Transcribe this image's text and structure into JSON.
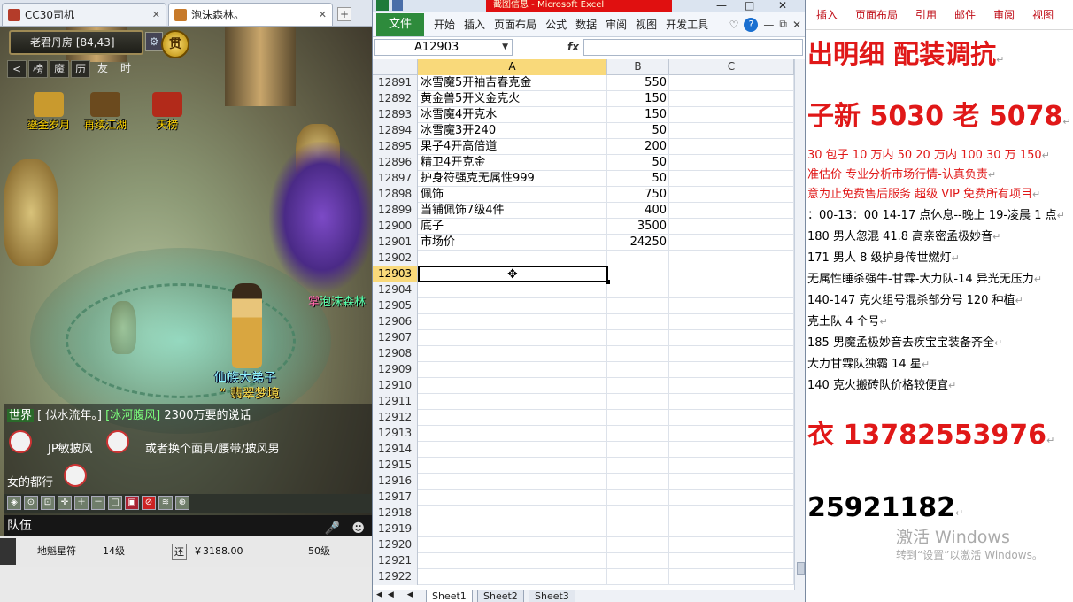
{
  "browser": {
    "tabs": [
      {
        "label": "CC30司机",
        "active": false
      },
      {
        "label": "泡沫森林。",
        "active": true
      }
    ],
    "new_tab": "+"
  },
  "game": {
    "location": "老君丹房 [84,43]",
    "gear_glyph": "⚙",
    "badge": "贯",
    "loc_tabs": [
      "<",
      "榜",
      "魔",
      "历"
    ],
    "loc_tabs_plain": [
      "友",
      "时"
    ],
    "top_icons": [
      {
        "label": "鎏金岁月",
        "color": "#c99a2e"
      },
      {
        "label": "再续江湖",
        "color": "#6b4a1e"
      },
      {
        "label": "天榜",
        "color": "#b22a1a"
      }
    ],
    "character_name": "仙族大弟子",
    "character_title": "“ 翡翠梦境",
    "npc_label": "泡沫森林",
    "chat": {
      "channel": "世界",
      "line1_prefix": "[ 似水流年。]",
      "line1_name": "[冰河腹风]",
      "line1_text": "2300万要的说话",
      "line2_a": "JP敏披风",
      "line2_b": "或者换个面具/腰带/披风男",
      "line3": "女的都行"
    },
    "toolbar_icons": [
      "◈",
      "⊙",
      "⊡",
      "✛",
      "＋",
      "－",
      "□",
      "▣",
      "⊘",
      "≋",
      "⊕"
    ],
    "team_label": "队伍",
    "mic_glyph": "🎤",
    "emo_glyph": "☻",
    "bottom": {
      "item": "地魁星符",
      "level": "14级",
      "btn": "还",
      "price": "￥3188.00",
      "level2": "50级"
    }
  },
  "excel": {
    "title_tab": "截图信息 - Microsoft Excel",
    "window_controls": [
      "—",
      "□",
      "✕"
    ],
    "ribbon_file": "文件",
    "ribbon_tabs": [
      "开始",
      "插入",
      "页面布局",
      "公式",
      "数据",
      "审阅",
      "视图",
      "开发工具"
    ],
    "ribbon_right": [
      "♡",
      "?",
      "—",
      "⧉",
      "✕"
    ],
    "namebox": "A12903",
    "fx": "fx",
    "columns": [
      "A",
      "B",
      "C"
    ],
    "selected_column": "A",
    "rows": [
      {
        "n": "12891",
        "a": "冰雪魔5开袖吉春克金",
        "b": "550"
      },
      {
        "n": "12892",
        "a": "黄金兽5开义金克火",
        "b": "150"
      },
      {
        "n": "12893",
        "a": "冰雪魔4开克水",
        "b": "150"
      },
      {
        "n": "12894",
        "a": "冰雪魔3开240",
        "b": "50"
      },
      {
        "n": "12895",
        "a": "果子4开高倍道",
        "b": "200"
      },
      {
        "n": "12896",
        "a": "精卫4开克金",
        "b": "50"
      },
      {
        "n": "12897",
        "a": "护身符强克无属性999",
        "b": "50"
      },
      {
        "n": "12898",
        "a": "佩饰",
        "b": "750"
      },
      {
        "n": "12899",
        "a": "当铺佩饰7级4件",
        "b": "400"
      },
      {
        "n": "12900",
        "a": "底子",
        "b": "3500"
      },
      {
        "n": "12901",
        "a": "市场价",
        "b": "24250"
      },
      {
        "n": "12902",
        "a": "",
        "b": ""
      },
      {
        "n": "12903",
        "a": "",
        "b": "",
        "selected": true
      },
      {
        "n": "12904",
        "a": "",
        "b": ""
      },
      {
        "n": "12905",
        "a": "",
        "b": ""
      },
      {
        "n": "12906",
        "a": "",
        "b": ""
      },
      {
        "n": "12907",
        "a": "",
        "b": ""
      },
      {
        "n": "12908",
        "a": "",
        "b": ""
      },
      {
        "n": "12909",
        "a": "",
        "b": ""
      },
      {
        "n": "12910",
        "a": "",
        "b": ""
      },
      {
        "n": "12911",
        "a": "",
        "b": ""
      },
      {
        "n": "12912",
        "a": "",
        "b": ""
      },
      {
        "n": "12913",
        "a": "",
        "b": ""
      },
      {
        "n": "12914",
        "a": "",
        "b": ""
      },
      {
        "n": "12915",
        "a": "",
        "b": ""
      },
      {
        "n": "12916",
        "a": "",
        "b": ""
      },
      {
        "n": "12917",
        "a": "",
        "b": ""
      },
      {
        "n": "12918",
        "a": "",
        "b": ""
      },
      {
        "n": "12919",
        "a": "",
        "b": ""
      },
      {
        "n": "12920",
        "a": "",
        "b": ""
      },
      {
        "n": "12921",
        "a": "",
        "b": ""
      },
      {
        "n": "12922",
        "a": "",
        "b": ""
      }
    ],
    "sheet_nav": "◀◀ ◀ ▶ ▶▶",
    "sheets": [
      "Sheet1",
      "Sheet2",
      "Sheet3"
    ],
    "active_sheet": "Sheet1"
  },
  "word": {
    "ribbon_tabs": [
      "插入",
      "页面布局",
      "引用",
      "邮件",
      "审阅",
      "视图"
    ],
    "lines": [
      "出明细 配装调抗",
      "子新 5030 老 5078",
      "30 包子  10 万内 50  20 万内 100  30 万 150",
      "准估价  专业分析市场行情-认真负责",
      "意为止免费售后服务   超级 VIP 免费所有项目",
      "：00-13：00  14-17 点休息--晚上 19-凌晨 1 点",
      "180 男人忽混 41.8 高亲密孟极妙音",
      "171 男人 8 级护身传世燃灯",
      "无属性睡杀强牛-甘霖-大力队-14 异光无压力",
      "140-147 克火组号混杀部分号 120 种植",
      "克土队 4 个号",
      "185 男魔孟极妙音去疾宝宝装备齐全",
      "大力甘霖队独霸 14 星",
      "140 克火搬砖队价格较便宜",
      "衣 13782553976",
      "25921182"
    ],
    "pilcrow": "↵",
    "activate_title": "激活 Windows",
    "activate_sub": "转到“设置”以激活 Windows。"
  }
}
